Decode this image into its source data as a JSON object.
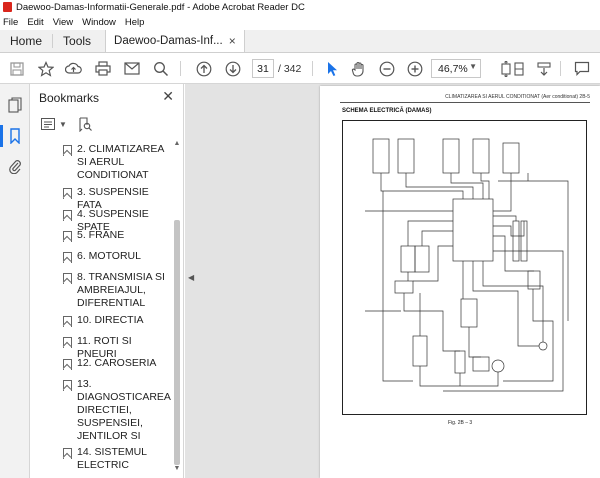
{
  "window": {
    "title": "Daewoo-Damas-Informatii-Generale.pdf - Adobe Acrobat Reader DC"
  },
  "menu": [
    "File",
    "Edit",
    "View",
    "Window",
    "Help"
  ],
  "tabs": {
    "home": "Home",
    "tools": "Tools",
    "document": "Daewoo-Damas-Inf...",
    "close_glyph": "×"
  },
  "toolbar": {
    "current_page": "31",
    "total_pages": "/ 342",
    "zoom": "46,7%",
    "icons": [
      "save-icon",
      "star-icon",
      "upload-icon",
      "print-icon",
      "mail-icon",
      "search-icon",
      "page-up-icon",
      "page-down-icon",
      "select-cursor-icon",
      "hand-icon",
      "zoom-out-icon",
      "zoom-in-icon",
      "fit-page-icon",
      "scroll-mode-icon",
      "download-icon",
      "comment-icon"
    ]
  },
  "bookmarks": {
    "header": "Bookmarks",
    "items": [
      "2. CLIMATIZAREA SI AERUL CONDITIONAT",
      "3. SUSPENSIE FATA",
      "4. SUSPENSIE SPATE",
      "5. FRANE",
      "6. MOTORUL",
      "8. TRANSMISIA SI AMBREIAJUL, DIFERENTIAL",
      "10. DIRECTIA",
      "11. ROTI SI PNEURI",
      "12. CAROSERIA",
      "13. DIAGNOSTICAREA DIRECTIEI, SUSPENSIEI, JENTILOR SI",
      "14. SISTEMUL ELECTRIC"
    ]
  },
  "page": {
    "header": "CLIMATIZAREA SI AERUL CONDITIONAT (Aer conditionat)  2B-5",
    "section_title": "SCHEMA ELECTRICĂ (DAMAS)",
    "figure_caption": "Fig.  2B – 3"
  }
}
